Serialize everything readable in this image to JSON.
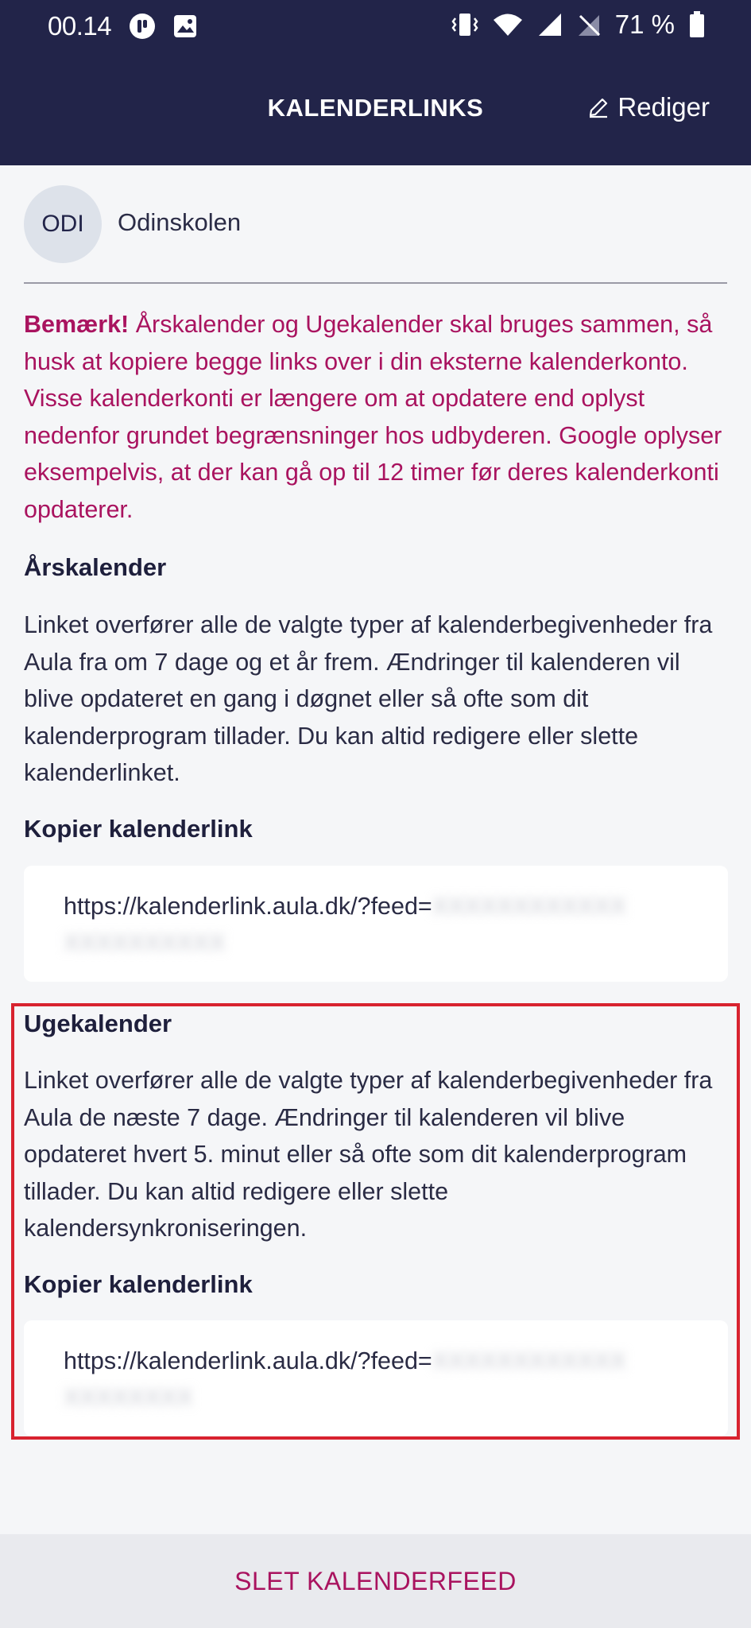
{
  "status_bar": {
    "time": "00.14",
    "battery": "71 %"
  },
  "header": {
    "title": "KALENDERLINKS",
    "edit_label": "Rediger"
  },
  "school": {
    "initials": "ODI",
    "name": "Odinskolen"
  },
  "notice": {
    "bold": "Bemærk!",
    "text": " Årskalender og Ugekalender skal bruges sammen, så husk at kopiere begge links over i din eksterne kalenderkonto. Visse kalenderkonti er længere om at opdatere end oplyst nedenfor grundet begrænsninger hos udbyderen. Google oplyser eksempelvis, at der kan gå op til 12 timer før deres kalenderkonti opdaterer."
  },
  "yearly": {
    "title": "Årskalender",
    "description": "Linket overfører alle de valgte typer af kalenderbegivenheder fra Aula fra om 7 dage og et år frem. Ændringer til kalenderen vil blive opdateret en gang i døgnet eller så ofte som dit kalenderprogram tillader. Du kan altid redigere eller slette kalenderlinket.",
    "copy_label": "Kopier kalenderlink",
    "link_prefix": "https://kalenderlink.aula.dk/?feed=",
    "link_obscured_1": "XXXXXXXXXXXX",
    "link_obscured_2": "XXXXXXXXXX"
  },
  "weekly": {
    "title": "Ugekalender",
    "description": "Linket overfører alle de valgte typer af kalenderbegivenheder fra Aula de næste 7 dage. Ændringer til kalenderen vil blive opdateret hvert 5. minut eller så ofte som dit kalenderprogram tillader. Du kan altid redigere eller slette kalendersynkroniseringen.",
    "copy_label": "Kopier kalenderlink",
    "link_prefix": "https://kalenderlink.aula.dk/?feed=",
    "link_obscured_1": "XXXXXXXXXXXX",
    "link_obscured_2": "XXXXXXXX"
  },
  "footer": {
    "delete_label": "SLET KALENDERFEED"
  },
  "colors": {
    "header_bg": "#222449",
    "accent": "#a9135f",
    "highlight": "#d8232f"
  }
}
